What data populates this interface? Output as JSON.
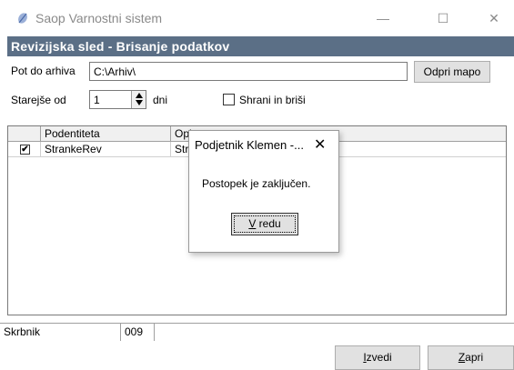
{
  "window": {
    "title": "Saop Varnostni sistem",
    "app_icon": "leaf-icon",
    "controls": {
      "minimize": "—",
      "maximize": "☐",
      "close": "✕"
    }
  },
  "banner": {
    "title": "Revizijska sled - Brisanje podatkov"
  },
  "form": {
    "path_label": "Pot do arhiva",
    "path_value": "C:\\Arhiv\\",
    "open_button": "Odpri mapo",
    "older_label": "Starejše od",
    "older_value": "1",
    "days_label": "dni",
    "save_delete_label": "Shrani in briši",
    "save_delete_checked": false
  },
  "grid": {
    "headers": [
      "",
      "Podentiteta",
      "Opis"
    ],
    "rows": [
      {
        "checked": true,
        "check_glyph": "✔",
        "podentiteta": "StrankeRev",
        "opis": "Str"
      }
    ]
  },
  "statusbar": {
    "label": "Skrbnik",
    "code": "009",
    "extra": ""
  },
  "buttons": {
    "run_mnemonic": "I",
    "run_rest": "zvedi",
    "close_mnemonic": "Z",
    "close_rest": "apri"
  },
  "dialog": {
    "title": "Podjetnik Klemen -...",
    "close_glyph": "✕",
    "message": "Postopek je zaključen.",
    "ok_mnemonic": "V",
    "ok_rest": " redu"
  },
  "colors": {
    "banner": "#5b6f86",
    "button_face": "#e1e1e1"
  }
}
